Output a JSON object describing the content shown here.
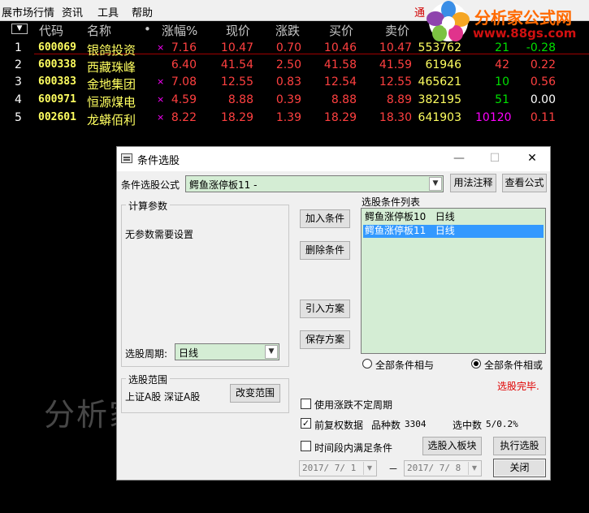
{
  "menu": {
    "items": [
      "展市场行情",
      "资讯",
      "工具",
      "帮助"
    ],
    "notice": "通"
  },
  "logo": {
    "text": "分析家公式网",
    "url": "www.88gs.com"
  },
  "grid": {
    "sort_icon": "▼",
    "columns": [
      "代码",
      "名称",
      "•",
      "涨幅%",
      "现价",
      "涨跌",
      "买价",
      "卖价"
    ],
    "rows": [
      {
        "idx": "1",
        "code": "600069",
        "name": "银鸽投资",
        "mark": "×",
        "change_pct": "7.16",
        "price": "10.47",
        "change": "0.70",
        "bid": "10.46",
        "ask": "10.47",
        "volume": "553762",
        "cur": "21",
        "speed": "-0.28"
      },
      {
        "idx": "2",
        "code": "600338",
        "name": "西藏珠峰",
        "mark": "",
        "change_pct": "6.40",
        "price": "41.54",
        "change": "2.50",
        "bid": "41.58",
        "ask": "41.59",
        "volume": "61946",
        "cur": "42",
        "speed": "0.22"
      },
      {
        "idx": "3",
        "code": "600383",
        "name": "金地集团",
        "mark": "×",
        "change_pct": "7.08",
        "price": "12.55",
        "change": "0.83",
        "bid": "12.54",
        "ask": "12.55",
        "volume": "465621",
        "cur": "10",
        "speed": "0.56"
      },
      {
        "idx": "4",
        "code": "600971",
        "name": "恒源煤电",
        "mark": "×",
        "change_pct": "4.59",
        "price": "8.88",
        "change": "0.39",
        "bid": "8.88",
        "ask": "8.89",
        "volume": "382195",
        "cur": "51",
        "speed": "0.00"
      },
      {
        "idx": "5",
        "code": "002601",
        "name": "龙蟒佰利",
        "mark": "×",
        "change_pct": "8.22",
        "price": "18.29",
        "change": "1.39",
        "bid": "18.29",
        "ask": "18.30",
        "volume": "641903",
        "cur": "10120",
        "speed": "0.11"
      }
    ]
  },
  "watermark": "分析家公式网www.88gs.com",
  "dialog": {
    "title": "条件选股",
    "window_buttons": {
      "minimize": "—",
      "maximize": "☐",
      "close": "✕"
    },
    "formula_label": "条件选股公式",
    "formula_value": "鳄鱼涨停板11 -",
    "usage_button": "用法注释",
    "view_formula_button": "查看公式",
    "params_group": "计算参数",
    "params_text": "无参数需要设置",
    "period_label": "选股周期:",
    "period_value": "日线",
    "add_button": "加入条件",
    "delete_button": "删除条件",
    "import_button": "引入方案",
    "save_button": "保存方案",
    "list_label": "选股条件列表",
    "list_items": [
      {
        "name": "鳄鱼涨停板10",
        "period": "日线",
        "selected": false
      },
      {
        "name": "鳄鱼涨停板11",
        "period": "日线",
        "selected": true
      }
    ],
    "radio_and": "全部条件相与",
    "radio_or": "全部条件相或",
    "status": "选股完毕.",
    "range_group": "选股范围",
    "range_text": "上证A股 深证A股",
    "change_range_button": "改变范围",
    "opt_unfixed_period": "使用涨跌不定周期",
    "opt_restore": "前复权数据",
    "count_label": "品种数",
    "count_value": "3304",
    "selected_label": "选中数",
    "selected_value": "5/0.2%",
    "opt_time_range": "时间段内满足条件",
    "to_block_button": "选股入板块",
    "run_button": "执行选股",
    "close_button": "关闭",
    "date_from": "2017/ 7/ 1",
    "date_sep": "－",
    "date_to": "2017/ 7/ 8"
  }
}
